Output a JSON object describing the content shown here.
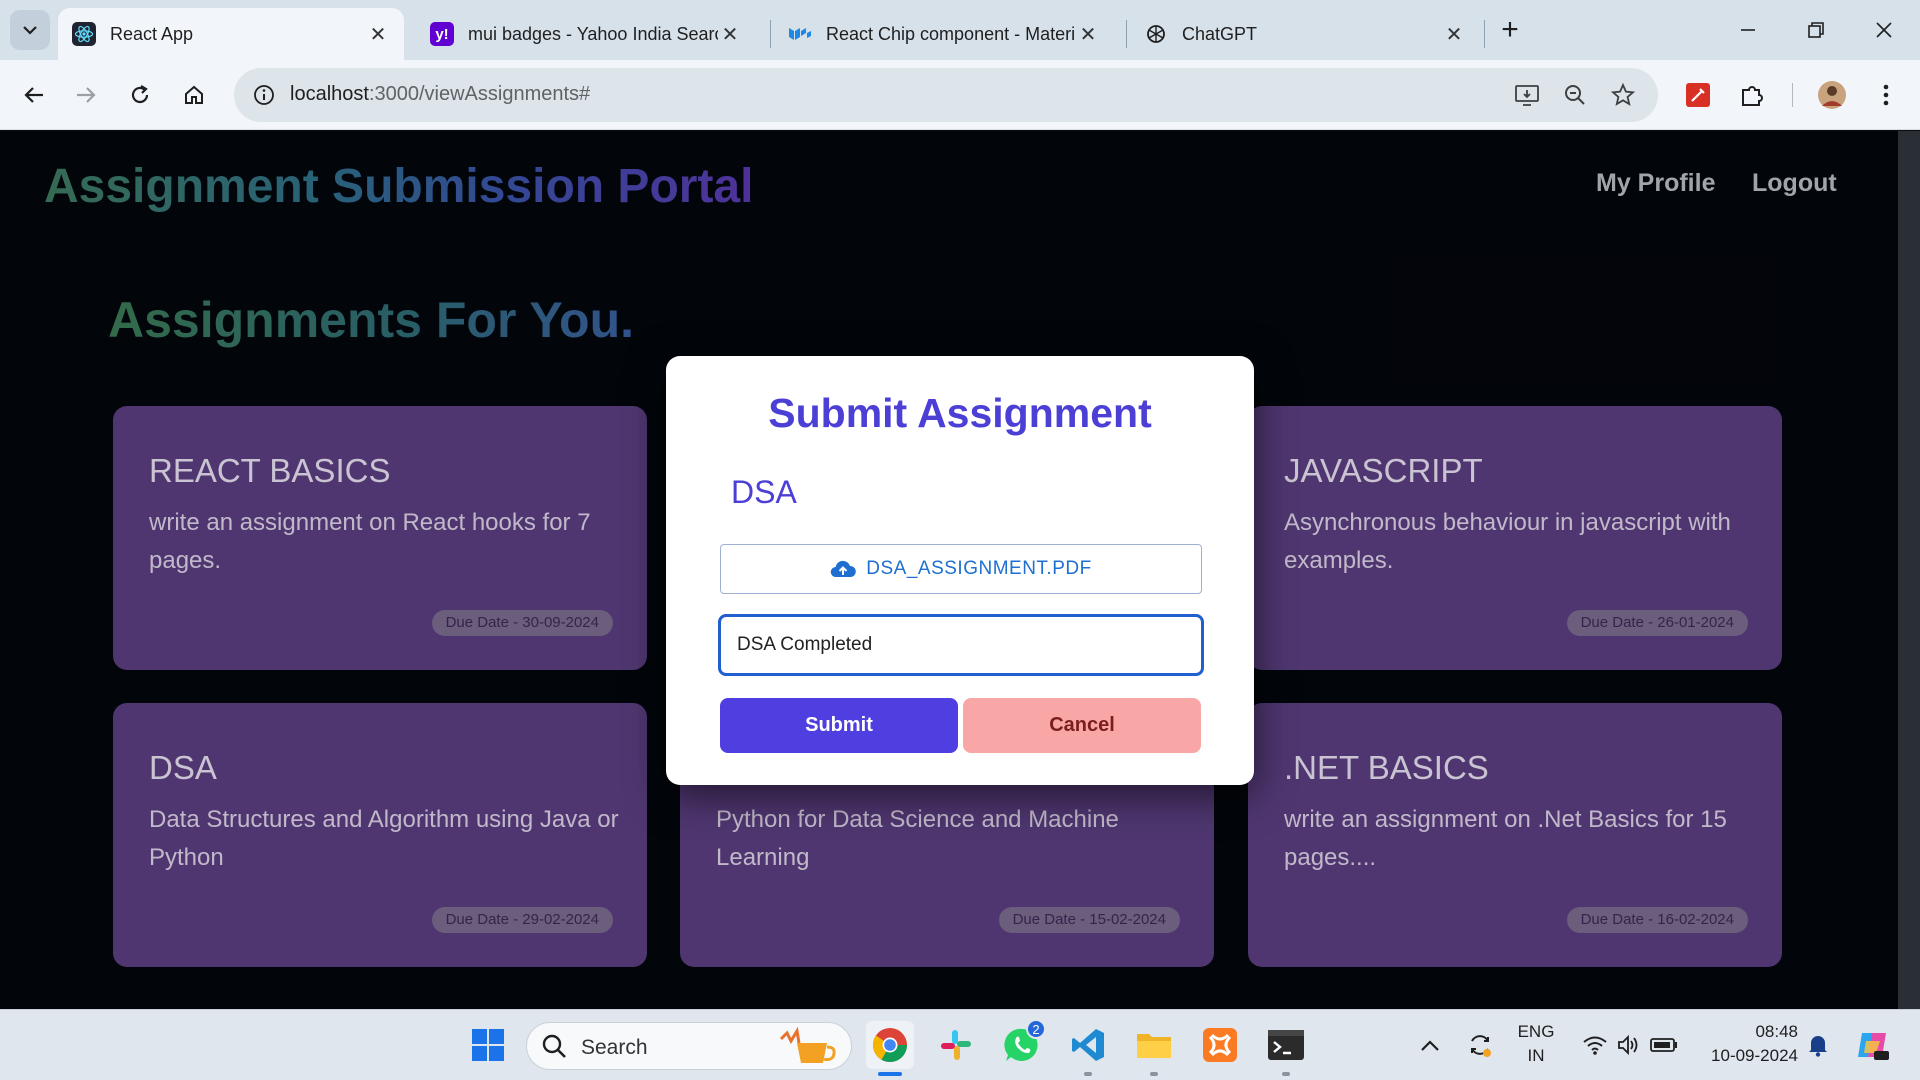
{
  "browser": {
    "tabs": [
      {
        "title": "React App",
        "icon": "react-icon",
        "active": true
      },
      {
        "title": "mui badges - Yahoo India Searc",
        "icon": "yahoo-icon",
        "active": false
      },
      {
        "title": "React Chip component - Materi",
        "icon": "mui-icon",
        "active": false
      },
      {
        "title": "ChatGPT",
        "icon": "openai-icon",
        "active": false
      }
    ],
    "url_host": "localhost",
    "url_path": ":3000/viewAssignments#"
  },
  "header": {
    "brand": "Assignment Submission Portal",
    "nav": [
      "My Profile",
      "Logout"
    ]
  },
  "main": {
    "section_title": "Assignments For You.",
    "cards": [
      {
        "title": "REACT BASICS",
        "desc": "write an assignment on React hooks for 7 pages.",
        "due": "Due Date - 30-09-2024"
      },
      {
        "title": "JAVASCRIPT",
        "desc": "Asynchronous behaviour in javascript with examples.",
        "due": "Due Date - 26-01-2024"
      },
      {
        "title": "DSA",
        "desc": "Data Structures and Algorithm using Java or Python",
        "due": "Due Date - 29-02-2024"
      },
      {
        "title": "",
        "desc": "Python for Data Science and Machine Learning",
        "due": "Due Date - 15-02-2024"
      },
      {
        "title": ".NET BASICS",
        "desc": "write an assignment on .Net Basics for 15 pages....",
        "due": "Due Date - 16-02-2024"
      }
    ]
  },
  "modal": {
    "title": "Submit Assignment",
    "subject": "DSA",
    "file_name": "DSA_ASSIGNMENT.PDF",
    "remark_value": "DSA Completed",
    "submit_label": "Submit",
    "cancel_label": "Cancel"
  },
  "taskbar": {
    "search_label": "Search",
    "whatsapp_badge": "2",
    "lang_line1": "ENG",
    "lang_line2": "IN",
    "time": "08:48",
    "date": "10-09-2024"
  },
  "colors": {
    "card_bg": "#5b3e80",
    "modal_accent": "#4b3fd6",
    "submit_bg": "#4f3fe0",
    "cancel_bg": "#f9a6a6"
  }
}
